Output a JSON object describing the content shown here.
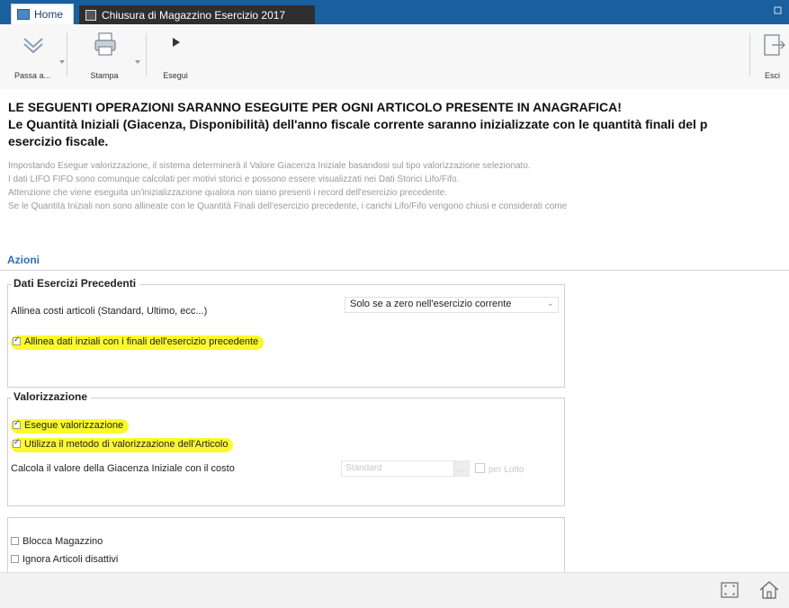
{
  "tabs": {
    "home": "Home",
    "document": "Chiusura di Magazzino Esercizio 2017"
  },
  "toolbar": {
    "passa": "Passa a...",
    "stampa": "Stampa",
    "esegui": "Esegui",
    "esci": "Esci"
  },
  "warnings": {
    "line1": "LE SEGUENTI OPERAZIONI SARANNO ESEGUITE PER OGNI ARTICOLO PRESENTE IN ANAGRAFICA!",
    "line2": "Le Quantità Iniziali (Giacenza, Disponibilità) dell'anno fiscale corrente saranno inizializzate con le quantità finali del p",
    "line3": "esercizio fiscale."
  },
  "info": [
    "Impostando Esegue valorizzazione, il sistema determinerà il Valore Giacenza Iniziale basandosi sul tipo valorizzazione selezionato.",
    "I dati LIFO FIFO sono comunque calcolati per motivi storici e possono essere visualizzati nei Dati Storici Lifo/Fifo.",
    "Attenzione che viene eseguita un'inizializzazione qualora non siano presenti i record dell'esercizio precedente.",
    "Se le Quantità Iniziali non sono allineate con le Quantità Finali dell'esercizio precedente, i carichi Lifo/Fifo vengono chiusi e considerati come"
  ],
  "section_title": "Azioni",
  "group1": {
    "title": "Dati Esercizi Precedenti",
    "allinea_costi_label": "Allinea costi articoli (Standard, Ultimo, ecc...)",
    "allinea_costi_value": "Solo se a zero nell'esercizio corrente",
    "allinea_dati_label": "Allinea dati inziali con i finali dell'esercizio precedente",
    "allinea_dati_checked": true
  },
  "group2": {
    "title": "Valorizzazione",
    "esegue_label": "Esegue valorizzazione",
    "esegue_checked": true,
    "utilizza_label": "Utilizza il metodo di valorizzazione dell'Articolo",
    "utilizza_checked": true,
    "calcola_label": "Calcola il valore della Giacenza Iniziale con il costo",
    "costo_value": "Standard",
    "per_lotto_label": "per Lotto"
  },
  "group3": {
    "blocca_label": "Blocca Magazzino",
    "blocca_checked": false,
    "ignora_label": "Ignora Articoli disattivi",
    "ignora_checked": false
  },
  "colors": {
    "titlebar": "#1a5f9e",
    "accent": "#2a72b8",
    "highlight": "#fbf92b"
  }
}
